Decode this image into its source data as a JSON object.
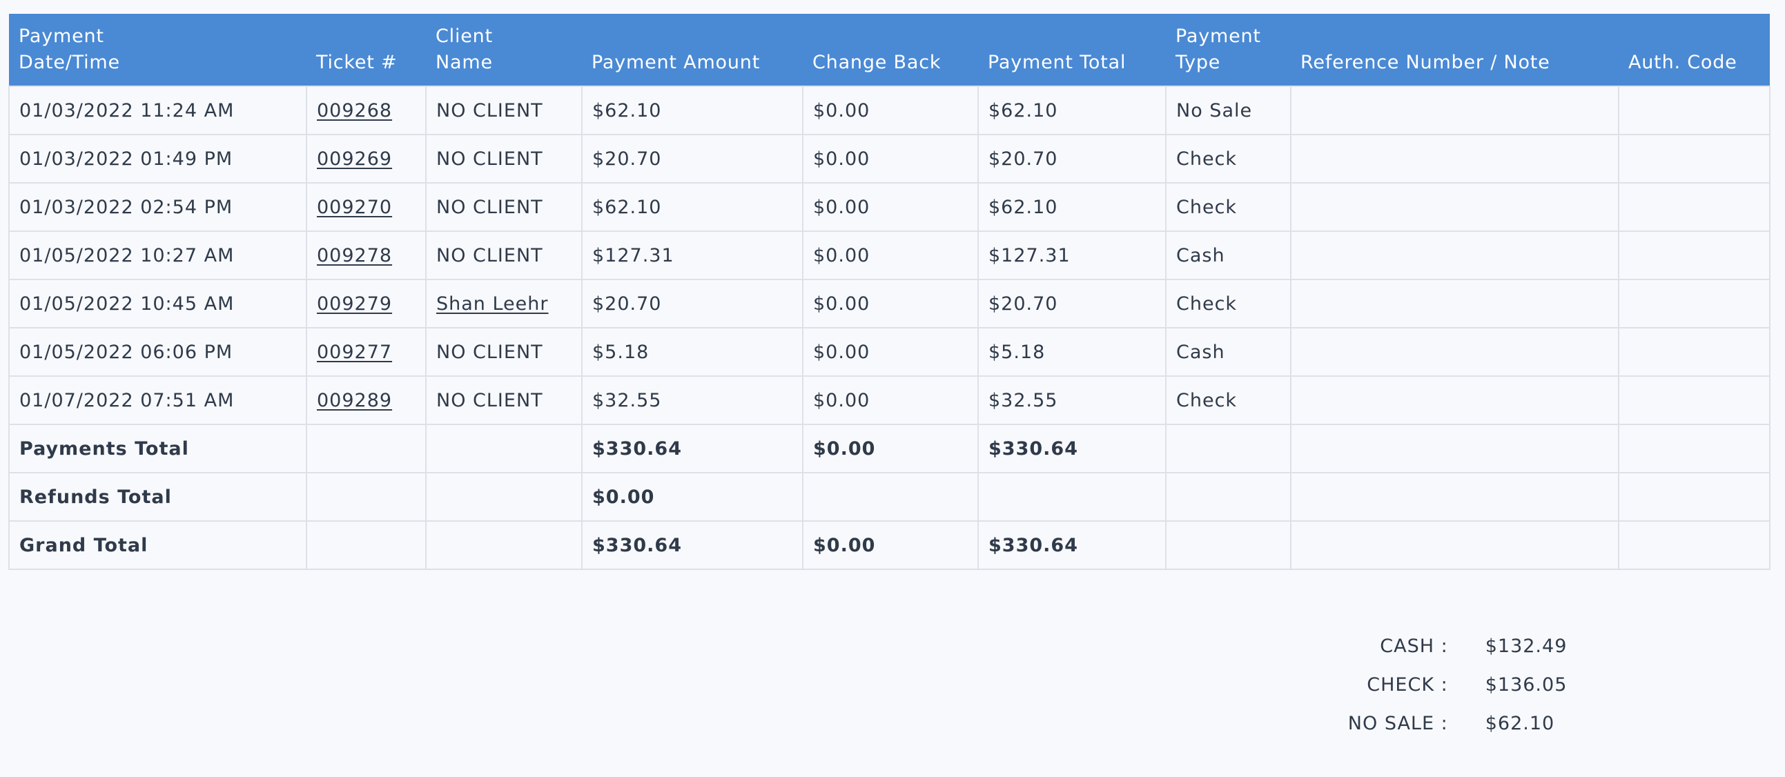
{
  "table": {
    "headers": [
      {
        "line1": "Payment",
        "line2": "Date/Time"
      },
      {
        "line1": "",
        "line2": "Ticket #"
      },
      {
        "line1": "Client",
        "line2": "Name"
      },
      {
        "line1": "",
        "line2": "Payment Amount"
      },
      {
        "line1": "",
        "line2": "Change Back"
      },
      {
        "line1": "",
        "line2": "Payment Total"
      },
      {
        "line1": "Payment",
        "line2": "Type"
      },
      {
        "line1": "",
        "line2": "Reference Number / Note"
      },
      {
        "line1": "",
        "line2": "Auth. Code"
      }
    ],
    "rows": [
      {
        "datetime": "01/03/2022 11:24 AM",
        "ticket": "009268",
        "client": "NO CLIENT",
        "amount": "$62.10",
        "change": "$0.00",
        "total": "$62.10",
        "type": "No Sale",
        "ref": "",
        "auth": ""
      },
      {
        "datetime": "01/03/2022 01:49 PM",
        "ticket": "009269",
        "client": "NO CLIENT",
        "amount": "$20.70",
        "change": "$0.00",
        "total": "$20.70",
        "type": "Check",
        "ref": "",
        "auth": ""
      },
      {
        "datetime": "01/03/2022 02:54 PM",
        "ticket": "009270",
        "client": "NO CLIENT",
        "amount": "$62.10",
        "change": "$0.00",
        "total": "$62.10",
        "type": "Check",
        "ref": "",
        "auth": ""
      },
      {
        "datetime": "01/05/2022 10:27 AM",
        "ticket": "009278",
        "client": "NO CLIENT",
        "amount": "$127.31",
        "change": "$0.00",
        "total": "$127.31",
        "type": "Cash",
        "ref": "",
        "auth": ""
      },
      {
        "datetime": "01/05/2022 10:45 AM",
        "ticket": "009279",
        "client": "Shan Leehr",
        "amount": "$20.70",
        "change": "$0.00",
        "total": "$20.70",
        "type": "Check",
        "ref": "",
        "auth": ""
      },
      {
        "datetime": "01/05/2022 06:06 PM",
        "ticket": "009277",
        "client": "NO CLIENT",
        "amount": "$5.18",
        "change": "$0.00",
        "total": "$5.18",
        "type": "Cash",
        "ref": "",
        "auth": ""
      },
      {
        "datetime": "01/07/2022 07:51 AM",
        "ticket": "009289",
        "client": "NO CLIENT",
        "amount": "$32.55",
        "change": "$0.00",
        "total": "$32.55",
        "type": "Check",
        "ref": "",
        "auth": ""
      }
    ],
    "totals": [
      {
        "label": "Payments Total",
        "amount": "$330.64",
        "change": "$0.00",
        "total": "$330.64"
      },
      {
        "label": "Refunds Total",
        "amount": "$0.00",
        "change": "",
        "total": ""
      },
      {
        "label": "Grand Total",
        "amount": "$330.64",
        "change": "$0.00",
        "total": "$330.64"
      }
    ]
  },
  "summary": [
    {
      "label": "CASH :",
      "value": "$132.49"
    },
    {
      "label": "CHECK :",
      "value": "$136.05"
    },
    {
      "label": "NO SALE :",
      "value": "$62.10"
    }
  ],
  "colors": {
    "header_bg": "#4a89d4",
    "header_text": "#ffffff",
    "text": "#2f3a4a",
    "border": "#dde1e7",
    "background": "#f8f9fc"
  }
}
